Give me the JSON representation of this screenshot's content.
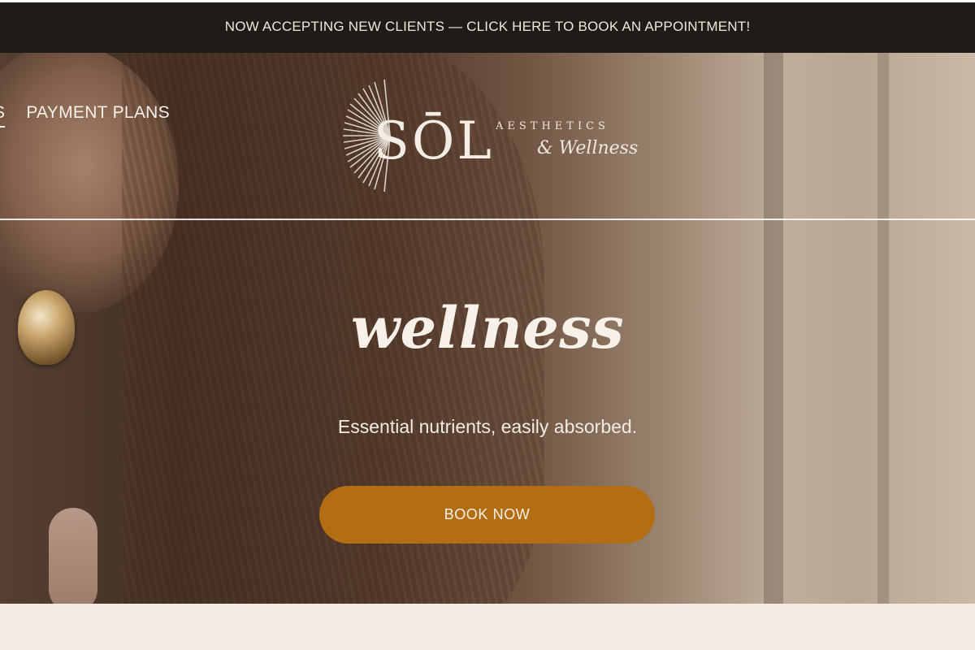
{
  "announcement": {
    "text": "NOW ACCEPTING NEW CLIENTS — CLICK HERE TO BOOK AN APPOINTMENT!"
  },
  "nav": {
    "items": [
      {
        "label": "S"
      },
      {
        "label": "PAYMENT PLANS"
      }
    ]
  },
  "logo": {
    "name": "SŌL",
    "tagline_top": "AESTHETICS",
    "tagline_script": "& Wellness"
  },
  "hero": {
    "title": "wellness",
    "subtitle": "Essential nutrients, easily absorbed.",
    "cta_label": "BOOK NOW"
  },
  "colors": {
    "announcement_bg": "#1f1c18",
    "cta_bg": "#b36e14",
    "page_bg": "#f4ece2",
    "text_light": "#f5f0ea"
  }
}
